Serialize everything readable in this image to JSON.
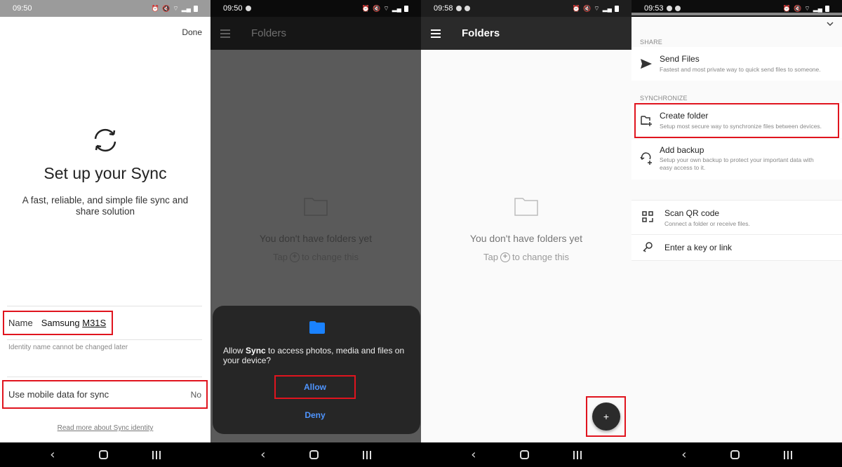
{
  "screens": [
    {
      "id": "setup",
      "status_time": "09:50",
      "done_label": "Done",
      "title": "Set up your Sync",
      "subtitle": "A fast, reliable, and simple file sync and share solution",
      "name_label": "Name",
      "name_value_part1": "Samsung ",
      "name_value_part2": "M31S",
      "identity_note": "Identity name cannot be changed later",
      "mobile_data_label": "Use mobile data for sync",
      "mobile_data_value": "No",
      "read_more_link": "Read more about Sync identity"
    },
    {
      "id": "folders-permission",
      "status_time": "09:50",
      "appbar_title": "Folders",
      "empty_title": "You don't have folders yet",
      "empty_hint_before": "Tap",
      "empty_hint_after": "to change this",
      "dialog_msg_before": "Allow ",
      "dialog_msg_app": "Sync",
      "dialog_msg_after": " to access photos, media and files on your device?",
      "allow_label": "Allow",
      "deny_label": "Deny"
    },
    {
      "id": "folders-empty",
      "status_time": "09:58",
      "appbar_title": "Folders",
      "empty_title": "You don't have folders yet",
      "empty_hint_before": "Tap",
      "empty_hint_after": "to change this",
      "fab_label": "+"
    },
    {
      "id": "add-menu",
      "status_time": "09:53",
      "share_section": "SHARE",
      "sync_section": "SYNCHRONIZE",
      "items": [
        {
          "label": "Send Files",
          "desc": "Fastest and most private way to quick send files to someone.",
          "icon": "send-icon"
        },
        {
          "label": "Create folder",
          "desc": "Setup most secure way to synchronize files between devices.",
          "icon": "create-folder-icon"
        },
        {
          "label": "Add backup",
          "desc": "Setup your own backup to protect your important data with easy access to it.",
          "icon": "backup-icon"
        },
        {
          "label": "Scan QR code",
          "desc": "Connect a folder or receive files.",
          "icon": "qr-code-icon"
        },
        {
          "label": "Enter a key or link",
          "desc": "",
          "icon": "key-icon"
        }
      ]
    }
  ],
  "colors": {
    "highlight": "#e0141e",
    "dialog_button": "#4f95ff",
    "permission_folder": "#1a82ff"
  }
}
